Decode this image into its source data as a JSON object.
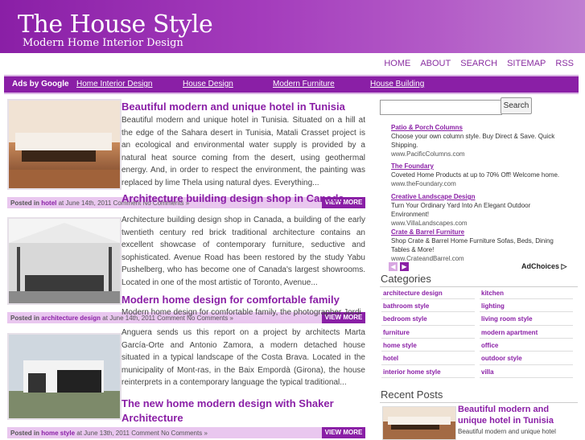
{
  "site": {
    "title": "The House Style",
    "tagline": "Modern Home Interior Design"
  },
  "topnav": [
    "HOME",
    "ABOUT",
    "SEARCH",
    "SITEMAP",
    "RSS"
  ],
  "navbar": {
    "ads_label": "Ads by Google",
    "links": [
      "Home Interior Design",
      "House Design",
      "Modern Furniture",
      "House Building"
    ]
  },
  "posts": [
    {
      "title": "Beautiful modern and unique hotel in Tunisia",
      "excerpt": "Beautiful modern and unique hotel in Tunisia. Situated on a hill at the edge of the Sahara desert in Tunisia, Matali Crasset project is an ecological and environmental water supply is provided by a natural heat source coming from the desert, using geothermal energy. And, in order to respect the environment, the painting was replaced by lime Thela using natural dyes. Everything...",
      "meta_prefix": "Posted in",
      "category": "hotel",
      "meta_date": "at June 14th, 2011",
      "comments": "Comment No Comments »",
      "view_more": "VIEW MORE"
    },
    {
      "title": "Architecture building design shop in Canada",
      "excerpt": "Architecture building design shop in Canada, a building of the early twentieth century red brick traditional architecture contains an excellent showcase of contemporary furniture, seductive and sophisticated. Avenue Road has been restored by the study Yabu Pushelberg, who has become one of Canada's largest showrooms. Located in one of the most artistic of Toronto, Avenue...",
      "meta_prefix": "Posted in",
      "category": "architecture design",
      "meta_date": "at June 14th, 2011",
      "comments": "Comment No Comments »",
      "view_more": "VIEW MORE"
    },
    {
      "title": "Modern home design for comfortable family",
      "excerpt_lead": "Modern home design for comfortable family, the photographer Jordi",
      "excerpt": "Anguera sends us this report on a project by architects Marta García-Orte and Antonio Zamora, a modern detached house situated in a typical landscape of the Costa Brava. Located in the municipality of Mont-ras, in the Baix Empordà (Girona), the house reinterprets in a contemporary language the typical traditional...",
      "meta_prefix": "Posted in",
      "category": "home style",
      "meta_date": "at June 13th, 2011",
      "comments": "Comment No Comments »",
      "view_more": "VIEW MORE"
    },
    {
      "title_line1": "The new home modern design with Shaker",
      "title_line2": "Architecture"
    }
  ],
  "search": {
    "button": "Search",
    "value": ""
  },
  "ads": [
    {
      "title": "Patio & Porch Columns",
      "desc": "Choose your own column style. Buy Direct & Save. Quick Shipping.",
      "url": "www.PacificColumns.com"
    },
    {
      "title": "The Foundary",
      "desc": "Coveted Home Products at up to 70% Off! Welcome home.",
      "url": "www.theFoundary.com"
    },
    {
      "title": "Creative Landscape Design",
      "desc": "Turn Your Ordinary Yard Into An Elegant Outdoor Environment!",
      "url": "www.VillaLandscapes.com"
    },
    {
      "title": "Crate & Barrel Furniture",
      "desc": "Shop Crate & Barrel Home Furniture Sofas, Beds, Dining Tables & More!",
      "url": "www.CrateandBarrel.com"
    }
  ],
  "adchoices": "AdChoices",
  "categories_heading": "Categories",
  "categories_left": [
    "architecture design",
    "bathroom style",
    "bedroom style",
    "furniture",
    "home style",
    "hotel",
    "interior home style"
  ],
  "categories_right": [
    "kitchen",
    "lighting",
    "living room style",
    "modern apartment",
    "office",
    "outdoor style",
    "villa"
  ],
  "recent_heading": "Recent Posts",
  "recent": {
    "title": "Beautiful modern and unique hotel in Tunisia",
    "excerpt": "Beautiful modern and unique hotel"
  },
  "colors": {
    "brand": "#8a1fa6",
    "meta_bg": "#e9c7ef"
  }
}
